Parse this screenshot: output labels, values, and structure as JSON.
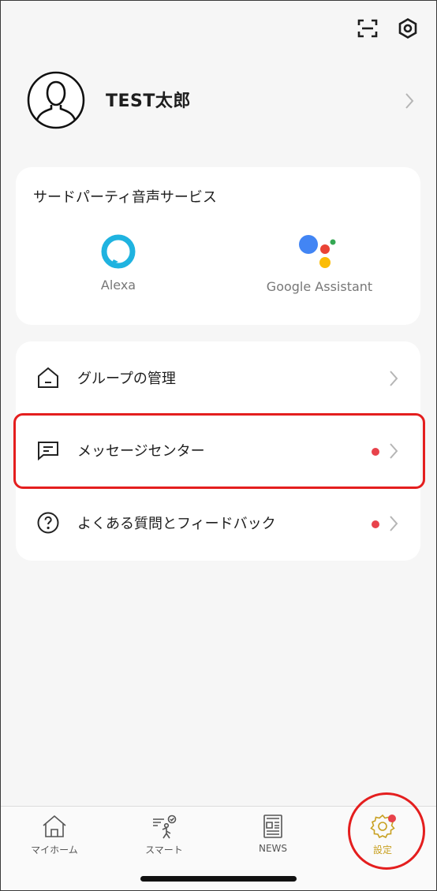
{
  "header": {
    "scan_icon": "scan-icon",
    "settings_icon": "hex-settings-icon"
  },
  "profile": {
    "name": "TEST太郎",
    "avatar_icon": "user-avatar-icon"
  },
  "voice_services": {
    "title": "サードパーティ音声サービス",
    "items": [
      {
        "label": "Alexa",
        "icon": "alexa-icon",
        "color": "#1fb3e0"
      },
      {
        "label": "Google Assistant",
        "icon": "google-assistant-icon"
      }
    ]
  },
  "menu": {
    "items": [
      {
        "label": "グループの管理",
        "icon": "home-outline-icon",
        "badge": false
      },
      {
        "label": "メッセージセンター",
        "icon": "message-icon",
        "badge": true
      },
      {
        "label": "よくある質問とフィードバック",
        "icon": "question-icon",
        "badge": true
      }
    ]
  },
  "tabbar": {
    "tabs": [
      {
        "label": "マイホーム",
        "icon": "home-icon"
      },
      {
        "label": "スマート",
        "icon": "smart-icon"
      },
      {
        "label": "NEWS",
        "icon": "news-icon"
      },
      {
        "label": "設定",
        "icon": "settings-gear-icon",
        "active": true,
        "badge": true
      }
    ]
  },
  "colors": {
    "badge": "#e8424b",
    "active_tab": "#c8a020",
    "highlight": "#e41e1e"
  }
}
